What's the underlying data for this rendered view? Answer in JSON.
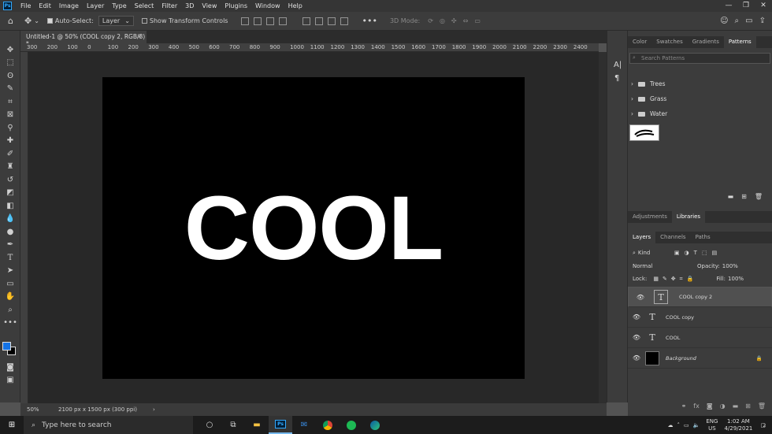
{
  "app": {
    "logo": "Ps"
  },
  "menu": [
    "File",
    "Edit",
    "Image",
    "Layer",
    "Type",
    "Select",
    "Filter",
    "3D",
    "View",
    "Plugins",
    "Window",
    "Help"
  ],
  "options": {
    "auto_select_label": "Auto-Select:",
    "auto_select_value": "Layer",
    "show_transform_label": "Show Transform Controls",
    "mode_3d_label": "3D Mode:"
  },
  "document": {
    "tab_title": "Untitled-1 @ 50% (COOL copy 2, RGB/8) *",
    "canvas_text": "COOL",
    "zoom": "50%",
    "doc_info": "2100 px x 1500 px (300 ppi)"
  },
  "ruler_ticks": [
    "300",
    "200",
    "100",
    "0",
    "100",
    "200",
    "300",
    "400",
    "500",
    "600",
    "700",
    "800",
    "900",
    "1000",
    "1100",
    "1200",
    "1300",
    "1400",
    "1500",
    "1600",
    "1700",
    "1800",
    "1900",
    "2000",
    "2100",
    "2200",
    "2300",
    "2400"
  ],
  "panels": {
    "top_tabs": [
      "Color",
      "Swatches",
      "Gradients",
      "Patterns"
    ],
    "search_placeholder": "Search Patterns",
    "folders": [
      "Trees",
      "Grass",
      "Water"
    ],
    "mid_tabs": [
      "Adjustments",
      "Libraries"
    ],
    "layer_tabs": [
      "Layers",
      "Channels",
      "Paths"
    ],
    "kind_label": "Kind",
    "blend_mode": "Normal",
    "opacity_label": "Opacity:",
    "opacity_value": "100%",
    "lock_label": "Lock:",
    "fill_label": "Fill:",
    "fill_value": "100%"
  },
  "layers": [
    {
      "name": "COOL copy 2",
      "type": "text",
      "selected": true
    },
    {
      "name": "COOL copy",
      "type": "text",
      "selected": false
    },
    {
      "name": "COOL",
      "type": "text",
      "selected": false
    },
    {
      "name": "Background",
      "type": "background",
      "selected": false
    }
  ],
  "taskbar": {
    "search_placeholder": "Type here to search",
    "lang": "ENG",
    "region": "US",
    "time": "1:02 AM",
    "date": "4/29/2021",
    "notifications": "2"
  }
}
